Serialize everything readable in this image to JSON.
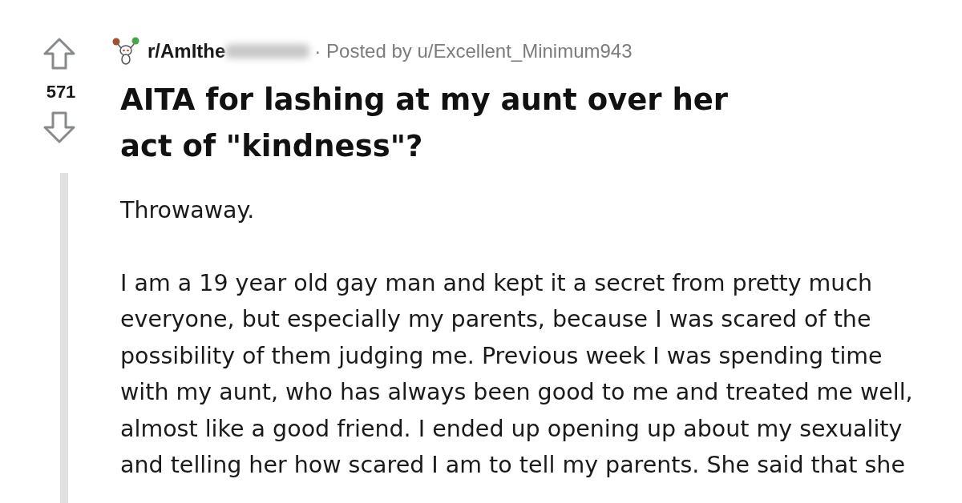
{
  "post": {
    "score": "571",
    "subreddit": "r/AmIthe",
    "posted_by": "· Posted by u/Excellent_Minimum943",
    "title": "AITA for lashing at my aunt over her act of \"kindness\"?",
    "body": [
      "Throwaway.",
      "I am a 19 year old gay man and kept it a secret from pretty much everyone, but especially my parents, because I was scared of the possibility of them judging me. Previous week I was spending time with my aunt, who has always been good to me and treated me well, almost like a good friend. I ended up opening up about my sexuality and telling her how scared I am to tell my parents. She said that she"
    ]
  }
}
